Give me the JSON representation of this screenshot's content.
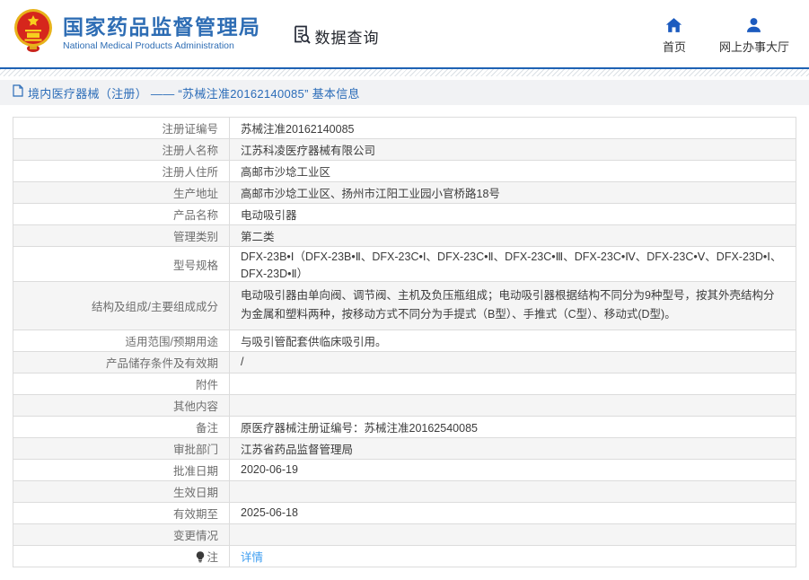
{
  "header": {
    "org_name": "国家药品监督管理局",
    "org_name_en": "National Medical Products Administration",
    "query_label": "数据查询",
    "nav": [
      {
        "label": "首页",
        "icon": "home-icon"
      },
      {
        "label": "网上办事大厅",
        "icon": "user-icon"
      }
    ]
  },
  "breadcrumb": {
    "text": "境内医疗器械（注册） ——  “苏械注准20162140085”  基本信息"
  },
  "table": {
    "rows": [
      {
        "label": "注册证编号",
        "value": "苏械注准20162140085"
      },
      {
        "label": "注册人名称",
        "value": "江苏科凌医疗器械有限公司"
      },
      {
        "label": "注册人住所",
        "value": "高邮市沙埝工业区"
      },
      {
        "label": "生产地址",
        "value": "高邮市沙埝工业区、扬州市江阳工业园小官桥路18号"
      },
      {
        "label": "产品名称",
        "value": "电动吸引器"
      },
      {
        "label": "管理类别",
        "value": "第二类"
      },
      {
        "label": "型号规格",
        "value": "DFX-23B•Ⅰ（DFX-23B•Ⅱ、DFX-23C•Ⅰ、DFX-23C•Ⅱ、DFX-23C•Ⅲ、DFX-23C•Ⅳ、DFX-23C•Ⅴ、DFX-23D•Ⅰ、DFX-23D•Ⅱ）"
      },
      {
        "label": "结构及组成/主要组成成分",
        "value": "电动吸引器由单向阀、调节阀、主机及负压瓶组成；电动吸引器根据结构不同分为9种型号，按其外壳结构分为金属和塑料两种，按移动方式不同分为手提式（B型）、手推式（C型）、移动式(D型)。",
        "tall": true
      },
      {
        "label": "适用范围/预期用途",
        "value": "与吸引管配套供临床吸引用。"
      },
      {
        "label": "产品储存条件及有效期",
        "value": "/"
      },
      {
        "label": "附件",
        "value": ""
      },
      {
        "label": "其他内容",
        "value": ""
      },
      {
        "label": "备注",
        "value": "原医疗器械注册证编号：苏械注准20162540085"
      },
      {
        "label": "审批部门",
        "value": "江苏省药品监督管理局"
      },
      {
        "label": "批准日期",
        "value": "2020-06-19"
      },
      {
        "label": "生效日期",
        "value": ""
      },
      {
        "label": "有效期至",
        "value": "2025-06-18"
      },
      {
        "label": "变更情况",
        "value": ""
      },
      {
        "label": "注",
        "value": "详情",
        "is_link": true,
        "label_icon": "bulb-icon"
      }
    ]
  },
  "colors": {
    "brand-blue": "#2e6db4",
    "icon-blue": "#1c5bbf",
    "link-blue": "#3d9df0",
    "crumb-text": "#2b6cb8",
    "crumb-bg": "#f1f2f4",
    "alt-row": "#f5f5f5",
    "border-gray": "#dcdcdc"
  }
}
